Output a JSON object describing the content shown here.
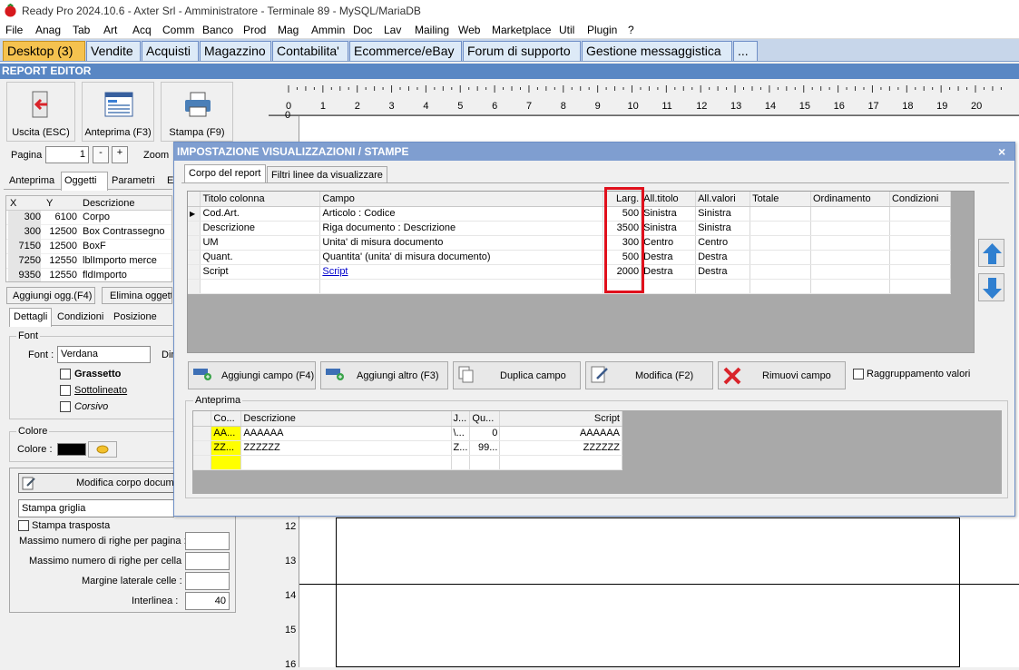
{
  "window_title": "Ready Pro 2024.10.6 - Axter Srl - Amministratore - Terminale 89 - MySQL/MariaDB",
  "menu": [
    "File",
    "Anag",
    "Tab",
    "Art",
    "Acq",
    "Comm",
    "Banco",
    "Prod",
    "Mag",
    "Ammin",
    "Doc",
    "Lav",
    "Mailing",
    "Web",
    "Marketplace",
    "Util",
    "Plugin",
    "?"
  ],
  "tabs": [
    "Desktop (3)",
    "Vendite",
    "Acquisti",
    "Magazzino",
    "Contabilita'",
    "Ecommerce/eBay",
    "Forum di supporto",
    "Gestione messaggistica",
    "..."
  ],
  "section_title": "REPORT EDITOR",
  "toolbar": {
    "exit": "Uscita (ESC)",
    "preview": "Anteprima (F3)",
    "print": "Stampa (F9)"
  },
  "page_label": "Pagina",
  "page_value": "1",
  "minus": "-",
  "plus": "+",
  "zoom_label": "Zoom",
  "ruler_top": [
    "0",
    "1",
    "2",
    "3",
    "4",
    "5",
    "6",
    "7",
    "8",
    "9",
    "10",
    "11",
    "12",
    "13",
    "14",
    "15",
    "16",
    "17",
    "18",
    "19",
    "20"
  ],
  "ruler_left": [
    "0",
    "12",
    "13",
    "14",
    "15",
    "16"
  ],
  "left_tabs": [
    "Anteprima",
    "Oggetti",
    "Parametri",
    "E"
  ],
  "objects": {
    "headers": [
      "X",
      "Y",
      "Descrizione"
    ],
    "rows": [
      {
        "x": "300",
        "y": "6100",
        "desc": "Corpo"
      },
      {
        "x": "300",
        "y": "12500",
        "desc": "Box Contrassegno"
      },
      {
        "x": "7150",
        "y": "12500",
        "desc": "BoxF"
      },
      {
        "x": "7250",
        "y": "12550",
        "desc": "lblImporto merce"
      },
      {
        "x": "9350",
        "y": "12550",
        "desc": "fldImporto"
      }
    ]
  },
  "obj_buttons": {
    "add": "Aggiungi ogg.(F4)",
    "remove": "Elimina oggett"
  },
  "detail_tabs": [
    "Dettagli",
    "Condizioni",
    "Posizione"
  ],
  "font": {
    "group": "Font",
    "label": "Font :",
    "value": "Verdana",
    "dim": "Dim",
    "bold": "Grassetto",
    "underline": "Sottolineato",
    "italic": "Corsivo"
  },
  "color": {
    "group": "Colore",
    "label": "Colore :"
  },
  "body_edit": "Modifica corpo docume",
  "grid_select": "Stampa griglia",
  "transposed": "Stampa trasposta",
  "params": [
    {
      "label": "Massimo numero di righe per pagina :",
      "value": ""
    },
    {
      "label": "Massimo numero di righe per cella :",
      "value": ""
    },
    {
      "label": "Margine laterale celle :",
      "value": ""
    },
    {
      "label": "Interlinea :",
      "value": "40"
    }
  ],
  "dialog": {
    "title": "IMPOSTAZIONE VISUALIZZAZIONI / STAMPE",
    "close": "×",
    "tabs": [
      "Corpo del report",
      "Filtri linee da visualizzare"
    ],
    "columns": [
      "Titolo colonna",
      "Campo",
      "Larg.",
      "All.titolo",
      "All.valori",
      "Totale",
      "Ordinamento",
      "Condizioni"
    ],
    "rows": [
      {
        "title": "Cod.Art.",
        "field": "Articolo : Codice",
        "width": "500",
        "t_align": "Sinistra",
        "v_align": "Sinistra"
      },
      {
        "title": "Descrizione",
        "field": "Riga documento : Descrizione",
        "width": "3500",
        "t_align": "Sinistra",
        "v_align": "Sinistra"
      },
      {
        "title": "UM",
        "field": "Unita' di misura documento",
        "width": "300",
        "t_align": "Centro",
        "v_align": "Centro"
      },
      {
        "title": "Quant.",
        "field": "Quantita' (unita' di misura documento)",
        "width": "500",
        "t_align": "Destra",
        "v_align": "Destra"
      },
      {
        "title": "Script",
        "field": "Script",
        "width": "2000",
        "t_align": "Destra",
        "v_align": "Destra"
      }
    ],
    "buttons": {
      "add_field": "Aggiungi campo (F4)",
      "add_other": "Aggiungi altro (F3)",
      "duplicate": "Duplica campo",
      "edit": "Modifica (F2)",
      "remove": "Rimuovi campo"
    },
    "grouping": "Raggruppamento valori",
    "preview_label": "Anteprima",
    "preview": {
      "headers": [
        "Co...",
        "Descrizione",
        "J...",
        "Qu...",
        "Script"
      ],
      "rows": [
        {
          "c": "AA...",
          "d": "AAAAAA",
          "j": "\\...",
          "q": "0",
          "s": "AAAAAA"
        },
        {
          "c": "ZZ...",
          "d": "ZZZZZZ",
          "j": "Z...",
          "q": "99...",
          "s": "ZZZZZZ"
        }
      ]
    }
  },
  "colors": {
    "highlight": "#e0101c",
    "accent_tab": "#f5c24f",
    "section_bar": "#5987c4",
    "preview_yellow": "#ffff00"
  }
}
